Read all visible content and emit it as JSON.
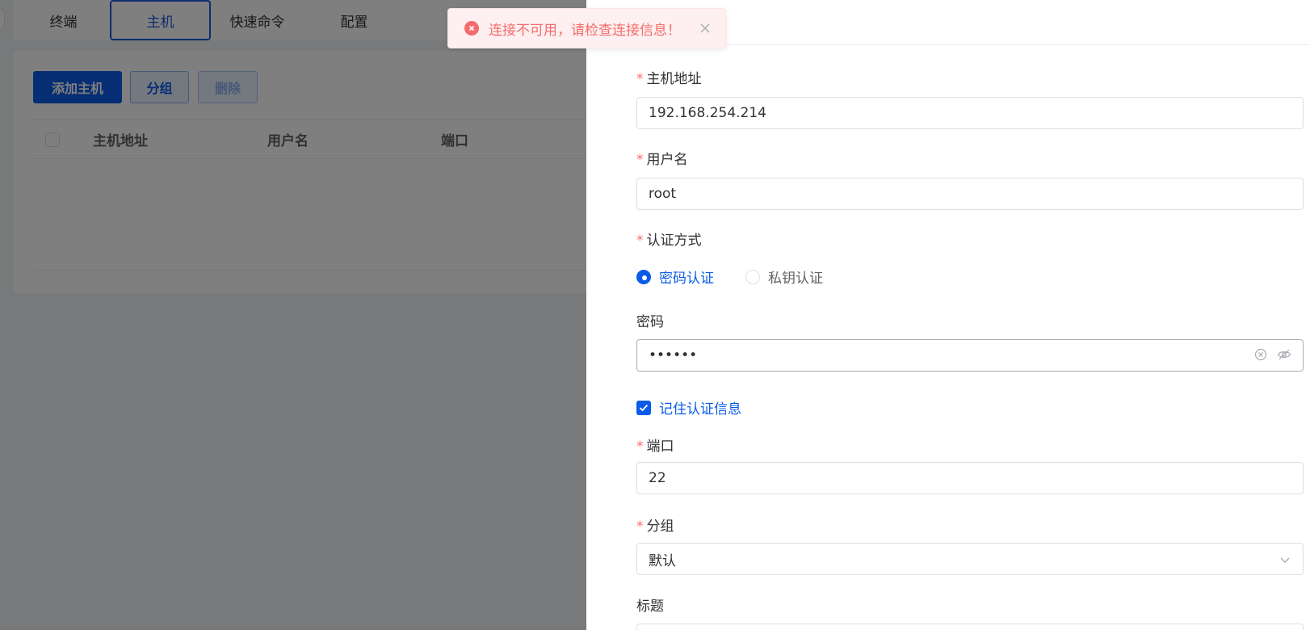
{
  "tabs": [
    {
      "label": "终端"
    },
    {
      "label": "主机",
      "active": true
    },
    {
      "label": "快速命令"
    },
    {
      "label": "配置"
    }
  ],
  "toolbar": {
    "add_host": "添加主机",
    "group": "分组",
    "delete": "删除"
  },
  "table": {
    "columns": [
      "主机地址",
      "用户名",
      "端口"
    ]
  },
  "drawer": {
    "title_fragment": "》",
    "host": {
      "label": "主机地址",
      "value": "192.168.254.214"
    },
    "username": {
      "label": "用户名",
      "value": "root"
    },
    "auth": {
      "label": "认证方式",
      "options": [
        "密码认证",
        "私钥认证"
      ],
      "selected": "密码认证"
    },
    "password": {
      "label": "密码",
      "value": "••••••"
    },
    "remember": {
      "label": "记住认证信息",
      "checked": true
    },
    "port": {
      "label": "端口",
      "value": "22"
    },
    "group": {
      "label": "分组",
      "value": "默认"
    },
    "title": {
      "label": "标题"
    }
  },
  "toast": {
    "type": "error",
    "message": "连接不可用，请检查连接信息！"
  },
  "colors": {
    "primary": "#0a5ce8",
    "error": "#f56c6c",
    "required": "#f56c6c"
  }
}
